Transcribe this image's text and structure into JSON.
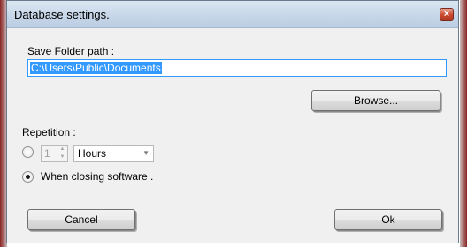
{
  "dialog": {
    "title": "Database settings.",
    "close_label": "×"
  },
  "save_folder": {
    "label": "Save Folder path :",
    "value": "C:\\Users\\Public\\Documents",
    "browse_label": "Browse..."
  },
  "repetition": {
    "label": "Repetition :",
    "interval_value": "1",
    "unit_selected": "Hours",
    "when_closing_label": "When closing software .",
    "selected_option": "when_closing"
  },
  "actions": {
    "cancel_label": "Cancel",
    "ok_label": "Ok"
  },
  "icons": {
    "spin_up": "▲",
    "spin_down": "▼",
    "dropdown": "▼"
  }
}
